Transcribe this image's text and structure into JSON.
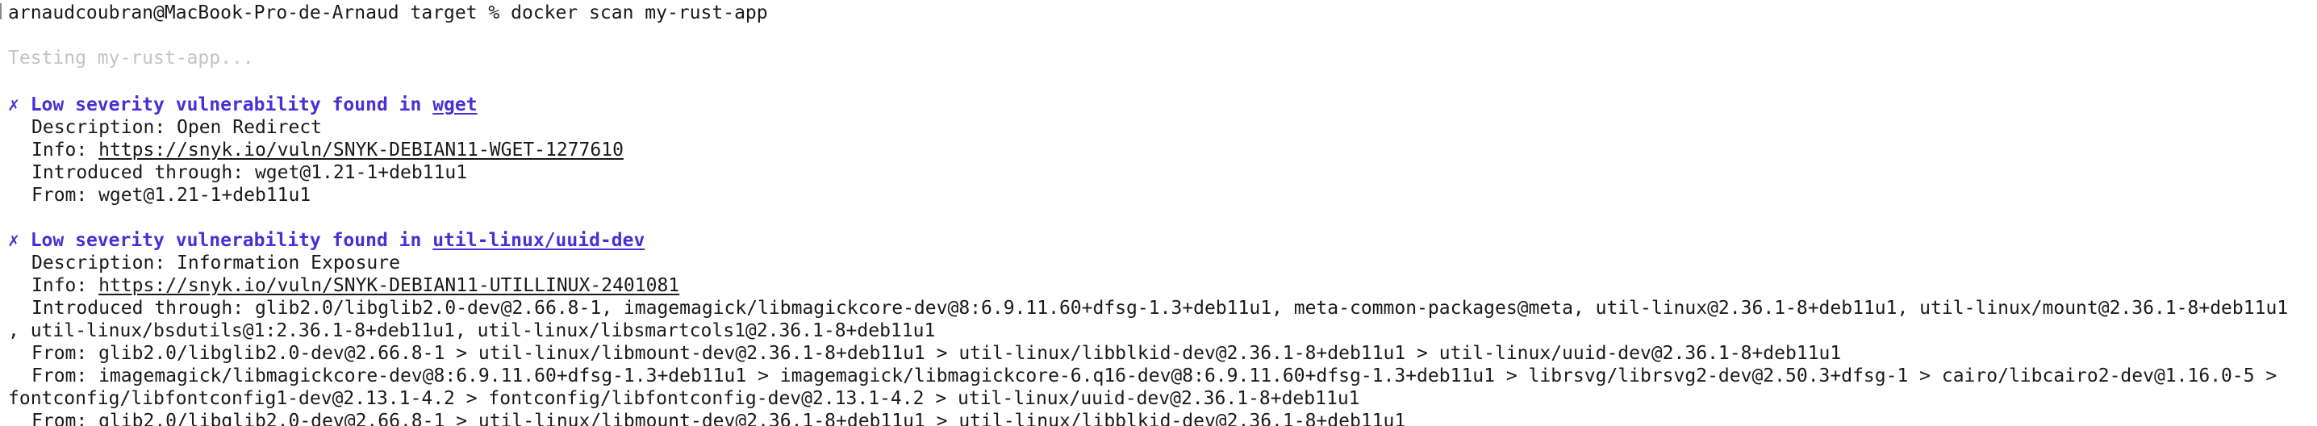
{
  "terminal": {
    "prompt": "arnaudcoubran@MacBook-Pro-de-Arnaud target % ",
    "command": "docker scan my-rust-app",
    "testing": "Testing my-rust-app...",
    "colors": {
      "background": "#ffffff",
      "text": "#1a1a1a",
      "accent": "#4a2fd6",
      "muted": "#c4c4c4"
    }
  },
  "vulns": [
    {
      "mark": "✗ ",
      "heading": "Low severity vulnerability found in ",
      "package": "wget",
      "desc_label": "Description: ",
      "desc": "Open Redirect",
      "info_label": "Info: ",
      "info_url": "https://snyk.io/vuln/SNYK-DEBIAN11-WGET-1277610",
      "intro_label": "Introduced through: ",
      "intro": "wget@1.21-1+deb11u1",
      "from": [
        "From: wget@1.21-1+deb11u1"
      ]
    },
    {
      "mark": "✗ ",
      "heading": "Low severity vulnerability found in ",
      "package": "util-linux/uuid-dev",
      "desc_label": "Description: ",
      "desc": "Information Exposure",
      "info_label": "Info: ",
      "info_url": "https://snyk.io/vuln/SNYK-DEBIAN11-UTILLINUX-2401081",
      "intro_label": "Introduced through: ",
      "intro": "glib2.0/libglib2.0-dev@2.66.8-1, imagemagick/libmagickcore-dev@8:6.9.11.60+dfsg-1.3+deb11u1, meta-common-packages@meta, util-linux@2.36.1-8+deb11u1, util-linux/mount@2.36.1-8+deb11u1",
      "intro_cont": ", util-linux/bsdutils@1:2.36.1-8+deb11u1, util-linux/libsmartcols1@2.36.1-8+deb11u1",
      "from": [
        "From: glib2.0/libglib2.0-dev@2.66.8-1 > util-linux/libmount-dev@2.36.1-8+deb11u1 > util-linux/libblkid-dev@2.36.1-8+deb11u1 > util-linux/uuid-dev@2.36.1-8+deb11u1",
        "From: imagemagick/libmagickcore-dev@8:6.9.11.60+dfsg-1.3+deb11u1 > imagemagick/libmagickcore-6.q16-dev@8:6.9.11.60+dfsg-1.3+deb11u1 > librsvg/librsvg2-dev@2.50.3+dfsg-1 > cairo/libcairo2-dev@1.16.0-5 >",
        "fontconfig/libfontconfig1-dev@2.13.1-4.2 > fontconfig/libfontconfig-dev@2.13.1-4.2 > util-linux/uuid-dev@2.36.1-8+deb11u1",
        "From: glib2.0/libglib2.0-dev@2.66.8-1 > util-linux/libmount-dev@2.36.1-8+deb11u1 > util-linux/libblkid-dev@2.36.1-8+deb11u1"
      ]
    }
  ]
}
